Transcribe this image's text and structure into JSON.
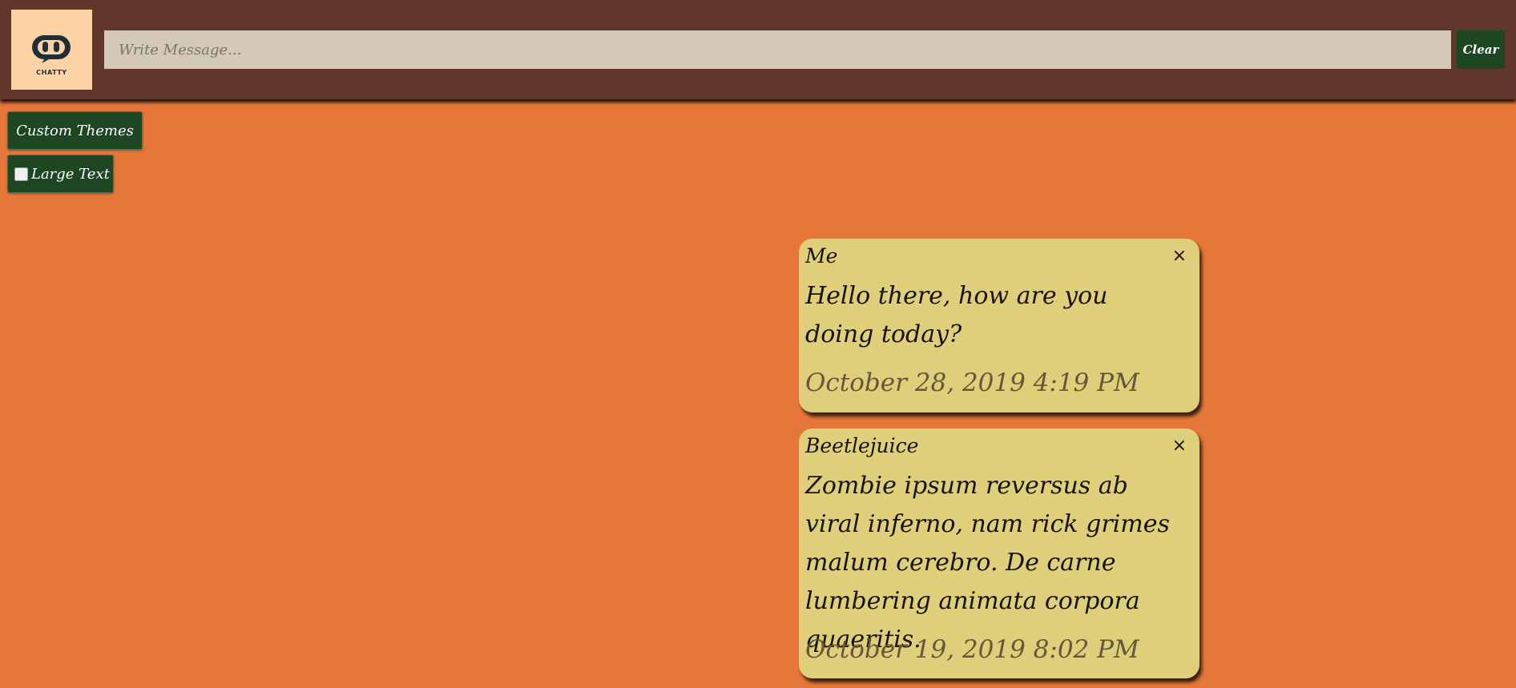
{
  "header": {
    "logo_text": "CHATTY",
    "message_placeholder": "Write Message...",
    "clear_label": "Clear"
  },
  "controls": {
    "custom_themes_label": "Custom Themes",
    "large_text_label": "Large Text",
    "large_text_checked": false
  },
  "messages": [
    {
      "author": "Me",
      "text": "Hello there, how are you doing today?",
      "timestamp": "October 28, 2019 4:19 PM",
      "close_label": "×"
    },
    {
      "author": "Beetlejuice",
      "text": "Zombie ipsum reversus ab viral inferno, nam rick grimes malum cerebro. De carne lumbering animata corpora quaeritis.",
      "timestamp": "October 19, 2019 8:02 PM",
      "close_label": "×"
    }
  ],
  "colors": {
    "page_background": "#e5773a",
    "header_background": "#60372a",
    "button_green": "#1d4723",
    "card_background": "#e0cf7a",
    "logo_background": "#fdd3a5"
  },
  "icons": {
    "logo": "chat-bubble-eyes-icon",
    "close": "close-icon",
    "checkbox": "checkbox-icon"
  }
}
